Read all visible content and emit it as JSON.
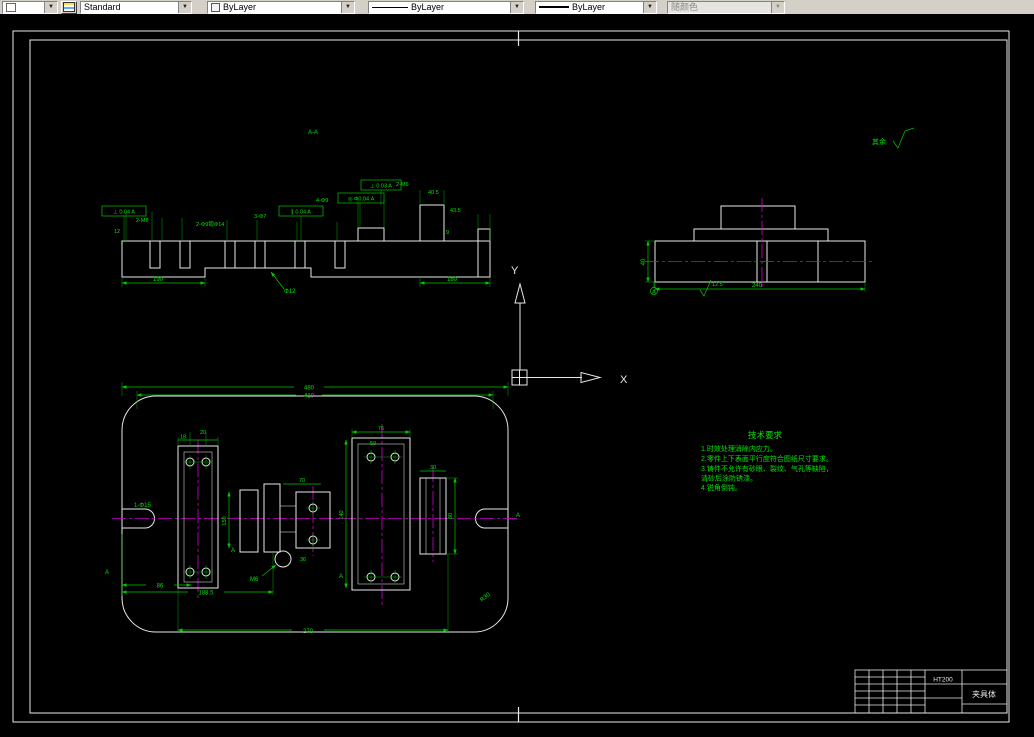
{
  "toolbar": {
    "arrow": "▼",
    "style": "Standard",
    "color": "ByLayer",
    "linetype": "ByLayer",
    "lineweight": "ByLayer",
    "plot_style": "随颜色"
  },
  "section": {
    "label": "A-A",
    "gdt": [
      "⊥ 0.04 A",
      "∥ 0.04 A",
      "◎ Φ0.04 A",
      "⊥ 0.03 A"
    ],
    "labels": {
      "l1": "2-M8",
      "l2": "2-Φ9锪Φ14",
      "l3": "3-Φ7",
      "l4": "4-Φ9",
      "l5": "2-M6",
      "l6": "40.5",
      "l7": "43.5",
      "l8": "9",
      "l9": "12"
    },
    "dims": {
      "d190": "190",
      "d180": "180",
      "dphi12": "Φ12"
    }
  },
  "ucs": {
    "x": "X",
    "y": "Y"
  },
  "side": {
    "d240": "240",
    "d40": "40",
    "rough": "12.5",
    "datum": "A"
  },
  "top": {
    "d480": "480",
    "d410": "410",
    "d270": "270",
    "d1885": "188.5",
    "d86": "86",
    "dphi15": "1-Φ15",
    "d18": "18",
    "d20": "20",
    "d76": "76",
    "d50": "50",
    "d30": "30",
    "d70": "70",
    "d36": "36",
    "dm6": "M6",
    "d140": "140",
    "d150": "150",
    "d80": "80",
    "dr30": "R30",
    "datum": "A"
  },
  "notes": {
    "title": "技术要求",
    "lines": [
      "1.时效处理消除内应力。",
      "2.零件上下表面平行度符合图纸尺寸要求。",
      "3.铸件不允许有砂眼、裂纹、气孔等缺陷，",
      "   清砂后涂防锈漆。",
      "4.锐角倒钝。"
    ]
  },
  "finish": {
    "label": "其余"
  },
  "titleblock": {
    "material": "HT200",
    "name": "夹具体"
  }
}
